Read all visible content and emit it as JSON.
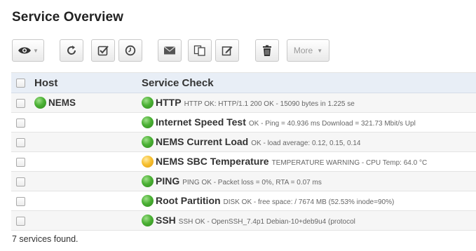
{
  "page": {
    "title": "Service Overview"
  },
  "toolbar": {
    "more_label": "More"
  },
  "table": {
    "headers": {
      "host": "Host",
      "service_check": "Service Check"
    },
    "rows": [
      {
        "host": "NEMS",
        "service": "HTTP",
        "status_text": "HTTP OK: HTTP/1.1 200 OK - 15090 bytes in 1.225 se",
        "state": "ok"
      },
      {
        "host": "",
        "service": "Internet Speed Test",
        "status_text": "OK - Ping = 40.936 ms Download = 321.73 Mbit/s Upl",
        "state": "ok"
      },
      {
        "host": "",
        "service": "NEMS Current Load",
        "status_text": "OK - load average: 0.12, 0.15, 0.14",
        "state": "ok"
      },
      {
        "host": "",
        "service": "NEMS SBC Temperature",
        "status_text": "TEMPERATURE WARNING - CPU Temp: 64.0 °C",
        "state": "warning"
      },
      {
        "host": "",
        "service": "PING",
        "status_text": "PING OK - Packet loss = 0%, RTA = 0.07 ms",
        "state": "ok"
      },
      {
        "host": "",
        "service": "Root Partition",
        "status_text": "DISK OK - free space: / 7674 MB (52.53% inode=90%)",
        "state": "ok"
      },
      {
        "host": "",
        "service": "SSH",
        "status_text": "SSH OK - OpenSSH_7.4p1 Debian-10+deb9u4 (protocol",
        "state": "ok"
      }
    ]
  },
  "footer": {
    "summary": "7 services found."
  },
  "colors": {
    "ok": "#4cb135",
    "warning": "#f7c132",
    "header_bg": "#e8eef6"
  }
}
